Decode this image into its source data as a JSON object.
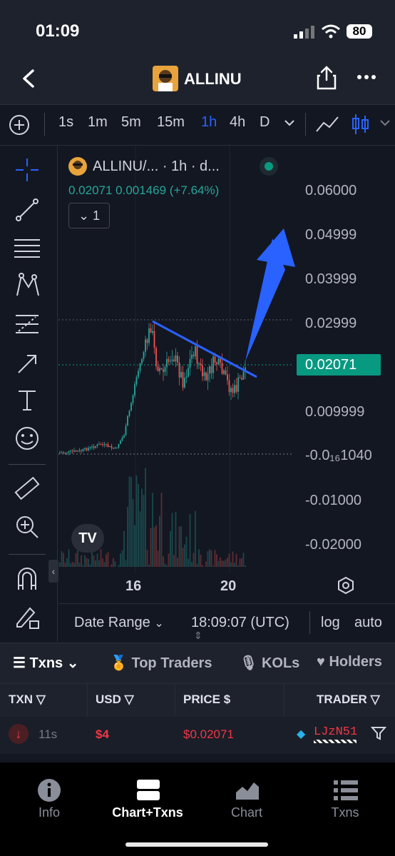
{
  "status_bar": {
    "time": "01:09",
    "battery": "80"
  },
  "header": {
    "title": "ALLINU"
  },
  "intervals": [
    "1s",
    "1m",
    "5m",
    "15m",
    "1h",
    "4h",
    "D"
  ],
  "active_interval": "1h",
  "legend": {
    "title": "ALLINU/... · 1h · d...",
    "values": "0.02071  0.001469 (+7.64%)",
    "collapse_count": "1"
  },
  "chart_data": {
    "type": "candlestick",
    "y_ticks": [
      "0.06000",
      "0.04999",
      "0.03999",
      "0.02999",
      "0.02071",
      "0.009999",
      "-0.0₁₆1040",
      "-0.01000",
      "-0.02000"
    ],
    "x_ticks": [
      "16",
      "20"
    ],
    "last_price": "0.02071"
  },
  "chart_bottom": {
    "date_range": "Date Range",
    "time": "18:09:07 (UTC)",
    "log": "log",
    "auto": "auto"
  },
  "tabs": {
    "txns": "Txns",
    "top_traders": "Top Traders",
    "kols": "KOLs",
    "holders": "Holders"
  },
  "table": {
    "headers": {
      "txn": "TXN",
      "usd": "USD",
      "price": "PRICE",
      "trader": "TRADER"
    },
    "rows": [
      {
        "age": "11s",
        "usd": "$4",
        "price": "$0.02071",
        "trader": "LJzN51"
      }
    ]
  },
  "nav": {
    "info": "Info",
    "chart_txns": "Chart+Txns",
    "chart": "Chart",
    "txns": "Txns"
  }
}
